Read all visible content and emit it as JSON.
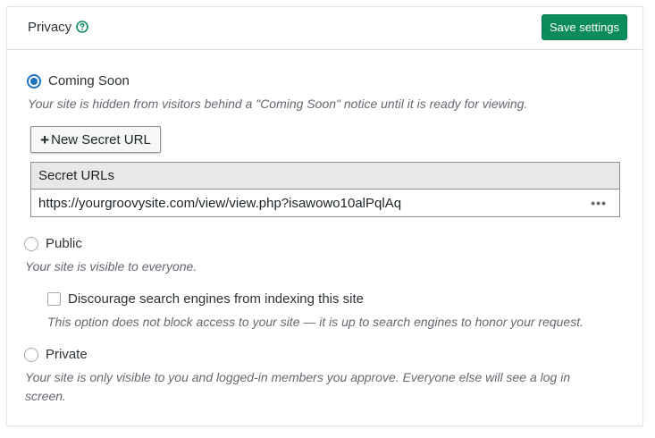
{
  "header": {
    "title": "Privacy",
    "help_icon": "question-circle-icon",
    "save_label": "Save settings",
    "accent_color": "#0c8b5b"
  },
  "options": {
    "coming_soon": {
      "label": "Coming Soon",
      "selected": true,
      "description": "Your site is hidden from visitors behind a \"Coming Soon\" notice until it is ready for viewing."
    },
    "new_secret_url": {
      "icon": "plus-icon",
      "label": "New Secret URL"
    },
    "secret_urls": {
      "header": "Secret URLs",
      "rows": [
        {
          "url": "https://yourgroovysite.com/view/view.php?isawowo10alPqlAq",
          "menu_icon": "ellipsis-icon"
        }
      ]
    },
    "public": {
      "label": "Public",
      "selected": false,
      "description": "Your site is visible to everyone."
    },
    "discourage": {
      "label": "Discourage search engines from indexing this site",
      "checked": false,
      "description": "This option does not block access to your site — it is up to search engines to honor your request."
    },
    "private": {
      "label": "Private",
      "selected": false,
      "description": "Your site is only visible to you and logged-in members you approve. Everyone else will see a log in screen."
    }
  }
}
